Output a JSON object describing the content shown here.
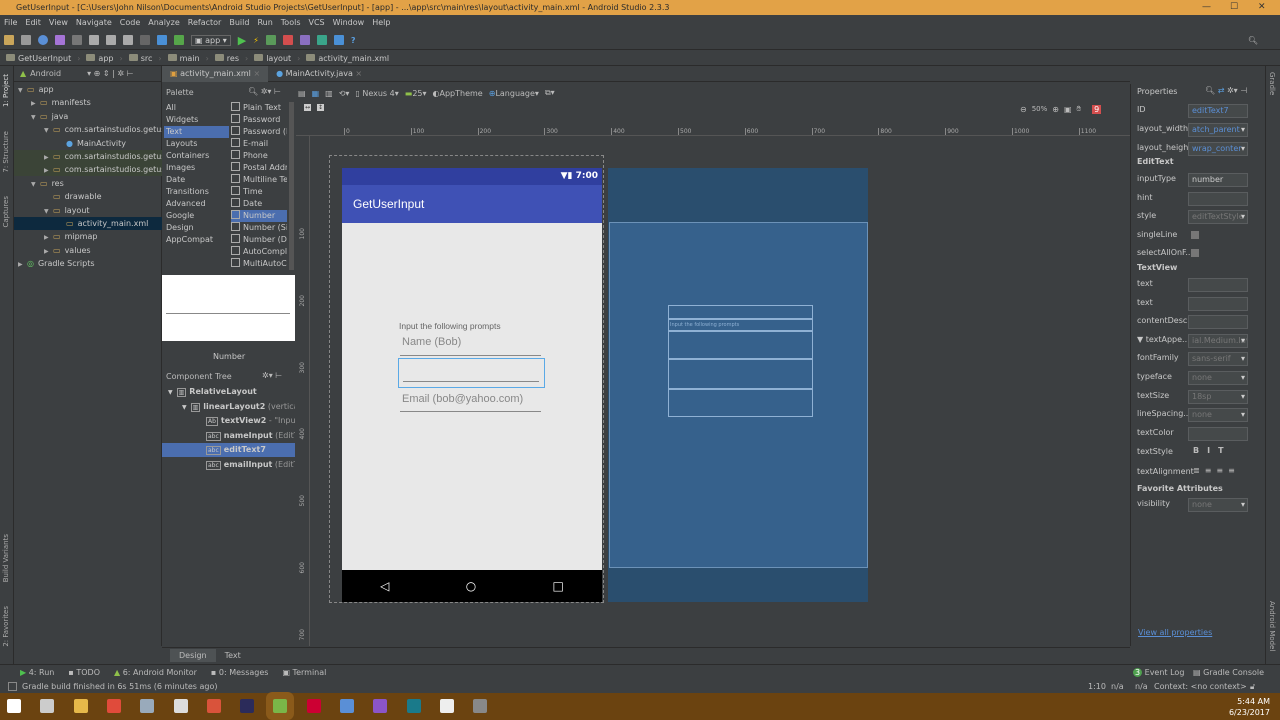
{
  "window": {
    "title": "GetUserInput - [C:\\Users\\John Nilson\\Documents\\Android Studio Projects\\GetUserInput] - [app] - ...\\app\\src\\main\\res\\layout\\activity_main.xml - Android Studio 2.3.3"
  },
  "menu": [
    "File",
    "Edit",
    "View",
    "Navigate",
    "Code",
    "Analyze",
    "Refactor",
    "Build",
    "Run",
    "Tools",
    "VCS",
    "Window",
    "Help"
  ],
  "toolbar": {
    "run_config": "app"
  },
  "breadcrumbs": [
    "GetUserInput",
    "app",
    "src",
    "main",
    "res",
    "layout",
    "activity_main.xml"
  ],
  "project": {
    "view": "Android",
    "items": [
      {
        "label": "app",
        "depth": 0,
        "arrow": "▼"
      },
      {
        "label": "manifests",
        "depth": 1,
        "arrow": "▶"
      },
      {
        "label": "java",
        "depth": 1,
        "arrow": "▼"
      },
      {
        "label": "com.sartainstudios.getuse",
        "depth": 2,
        "arrow": "▼"
      },
      {
        "label": "MainActivity",
        "depth": 3,
        "arrow": ""
      },
      {
        "label": "com.sartainstudios.getuse",
        "depth": 2,
        "arrow": "▶"
      },
      {
        "label": "com.sartainstudios.getuse",
        "depth": 2,
        "arrow": "▶"
      },
      {
        "label": "res",
        "depth": 1,
        "arrow": "▼"
      },
      {
        "label": "drawable",
        "depth": 2,
        "arrow": ""
      },
      {
        "label": "layout",
        "depth": 2,
        "arrow": "▼"
      },
      {
        "label": "activity_main.xml",
        "depth": 3,
        "arrow": ""
      },
      {
        "label": "mipmap",
        "depth": 2,
        "arrow": "▶"
      },
      {
        "label": "values",
        "depth": 2,
        "arrow": "▶"
      },
      {
        "label": "Gradle Scripts",
        "depth": 0,
        "arrow": "▶"
      }
    ]
  },
  "left_strip": [
    "1: Project",
    "7: Structure",
    "Captures",
    "Build Variants",
    "2: Favorites"
  ],
  "right_strip": [
    "Gradle",
    "Android Model"
  ],
  "editor_tabs": [
    "activity_main.xml",
    "MainActivity.java"
  ],
  "palette": {
    "title": "Palette",
    "categories": [
      "All",
      "Widgets",
      "Text",
      "Layouts",
      "Containers",
      "Images",
      "Date",
      "Transitions",
      "Advanced",
      "Google",
      "Design",
      "AppCompat"
    ],
    "items": [
      "Plain Text",
      "Password",
      "Password (N",
      "E-mail",
      "Phone",
      "Postal Addr",
      "Multiline Te",
      "Time",
      "Date",
      "Number",
      "Number (Si",
      "Number (De",
      "AutoCompl",
      "MultiAutoC"
    ],
    "preview_label": "Number"
  },
  "design_toolbar": {
    "device": "Nexus 4",
    "api": "25",
    "theme": "AppTheme",
    "language": "Language",
    "zoom": "50%",
    "errors": "9"
  },
  "ruler": {
    "h": [
      "0",
      "100",
      "200",
      "300",
      "400",
      "500",
      "600",
      "700",
      "800",
      "900",
      "1000",
      "1100"
    ],
    "v": [
      "100",
      "200",
      "300",
      "400",
      "500",
      "600",
      "700"
    ]
  },
  "component_tree": {
    "title": "Component Tree",
    "items": [
      {
        "label": "RelativeLayout",
        "extra": "",
        "depth": 0
      },
      {
        "label": "linearLayout2",
        "extra": " (vertical)",
        "depth": 1
      },
      {
        "label": "textView2",
        "extra": " - \"Input th",
        "depth": 2
      },
      {
        "label": "nameInput",
        "extra": " (EditText)",
        "depth": 2
      },
      {
        "label": "editText7",
        "extra": "",
        "depth": 2
      },
      {
        "label": "emailInput",
        "extra": " (EditText)",
        "depth": 2
      }
    ]
  },
  "phone": {
    "time": "7:00",
    "app_title": "GetUserInput",
    "prompt": "Input the following prompts",
    "name_hint": "Name (Bob)",
    "email_hint": "Email (bob@yahoo.com)"
  },
  "blueprint": {
    "prompt": "Input the following prompts"
  },
  "properties": {
    "title": "Properties",
    "id": "editText7",
    "layout_width": "atch_parent",
    "layout_height": "wrap_conter",
    "edittext_header": "EditText",
    "inputType": "number",
    "hint": "",
    "style": "editTextStyle",
    "textview_header": "TextView",
    "textAppearance": "ial.Medium.Inve",
    "fontFamily": "sans-serif",
    "typeface": "none",
    "textSize": "18sp",
    "lineSpacing": "none",
    "favorites_header": "Favorite Attributes",
    "visibility": "none",
    "view_all": "View all properties",
    "labels": {
      "id": "ID",
      "lw": "layout_width",
      "lh": "layout_height",
      "inputType": "inputType",
      "hint": "hint",
      "style": "style",
      "singleLine": "singleLine",
      "selectAll": "selectAllOnF...",
      "text": "text",
      "text2": "text",
      "contentDesc": "contentDesc...",
      "textAppe": "▼ textAppe...",
      "fontFamily": "fontFamily",
      "typeface": "typeface",
      "textSize": "textSize",
      "lineSpacing": "lineSpacing...",
      "textColor": "textColor",
      "textStyle": "textStyle",
      "textAlignment": "textAlignment",
      "visibility": "visibility"
    }
  },
  "bottom_tabs": [
    "Design",
    "Text"
  ],
  "tool_windows": [
    "4: Run",
    "TODO",
    "6: Android Monitor",
    "0: Messages",
    "Terminal"
  ],
  "tool_windows_right": {
    "event_log": "Event Log",
    "event_count": "3",
    "gradle_console": "Gradle Console"
  },
  "status": {
    "message": "Gradle build finished in 6s 51ms (6 minutes ago)",
    "position": "1:10",
    "a": "n/a",
    "b": "n/a",
    "context": "Context: <no context>"
  },
  "taskbar": {
    "time": "5:44 AM",
    "date": "6/23/2017"
  }
}
